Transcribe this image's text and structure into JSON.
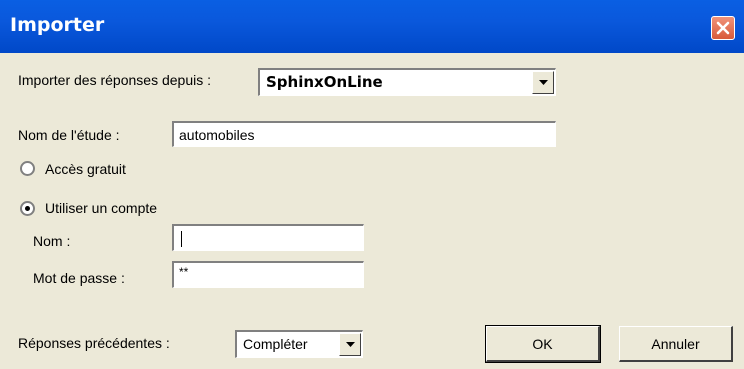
{
  "window": {
    "title": "Importer",
    "close_icon": "close-icon"
  },
  "source": {
    "label": "Importer des réponses depuis :",
    "selected": "SphinxOnLine"
  },
  "study": {
    "label": "Nom de l'étude :",
    "value": "automobiles"
  },
  "access": {
    "free_label": "Accès gratuit",
    "account_label": "Utiliser un compte",
    "selected": "account"
  },
  "account": {
    "name_label": "Nom :",
    "name_value": "",
    "password_label": "Mot de passe :",
    "password_value": "**"
  },
  "previous": {
    "label": "Réponses précédentes :",
    "selected": "Compléter"
  },
  "buttons": {
    "ok": "OK",
    "cancel": "Annuler"
  },
  "colors": {
    "titlebar": "#0a58dc",
    "window_bg": "#ece9d8",
    "close_button": "#d85a3a"
  }
}
